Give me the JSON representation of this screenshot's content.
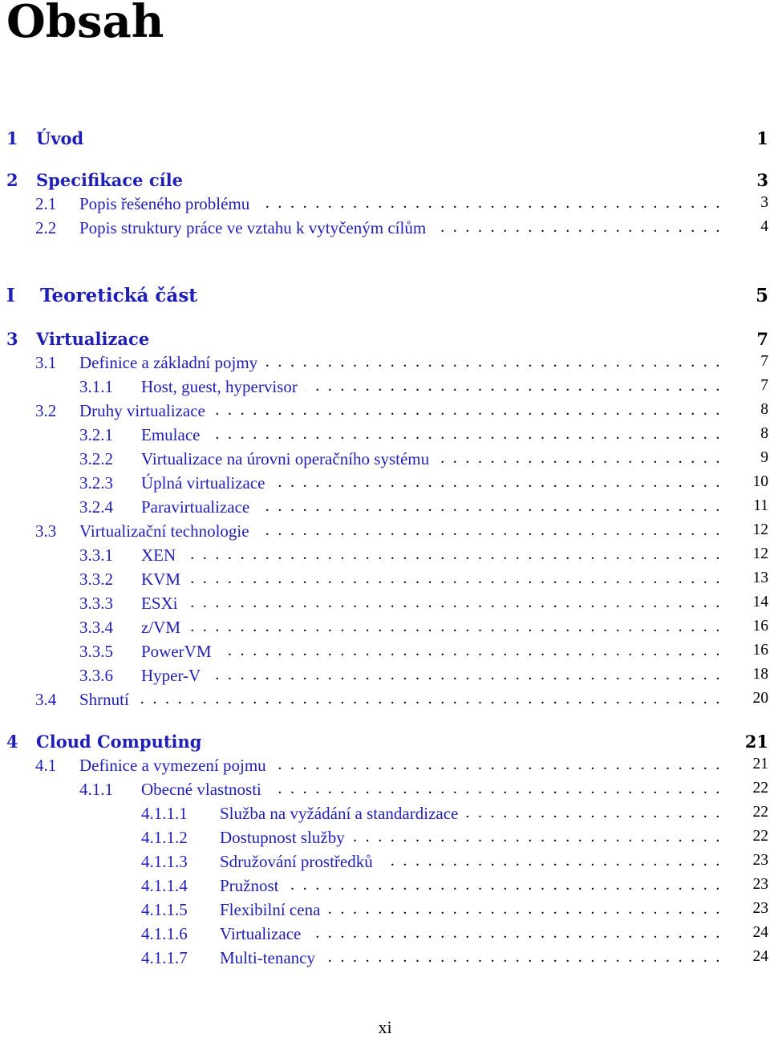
{
  "title": "Obsah",
  "link_color": "#1f1fb5",
  "entries": [
    {
      "level": "chapter",
      "num": "1",
      "title": "Úvod",
      "page": "1"
    },
    {
      "level": "chapter",
      "num": "2",
      "title": "Specifikace cíle",
      "page": "3"
    },
    {
      "level": "section",
      "num": "2.1",
      "title": "Popis řešeného problému",
      "page": "3"
    },
    {
      "level": "section",
      "num": "2.2",
      "title": "Popis struktury práce ve vztahu k vytyčeným cílům",
      "page": "4"
    },
    {
      "level": "part",
      "num": "I",
      "title": "Teoretická část",
      "page": "5"
    },
    {
      "level": "chapter",
      "num": "3",
      "title": "Virtualizace",
      "page": "7"
    },
    {
      "level": "section",
      "num": "3.1",
      "title": "Definice a základní pojmy",
      "page": "7"
    },
    {
      "level": "subsection",
      "num": "3.1.1",
      "title": "Host, guest, hypervisor",
      "page": "7"
    },
    {
      "level": "section",
      "num": "3.2",
      "title": "Druhy virtualizace",
      "page": "8"
    },
    {
      "level": "subsection",
      "num": "3.2.1",
      "title": "Emulace",
      "page": "8"
    },
    {
      "level": "subsection",
      "num": "3.2.2",
      "title": "Virtualizace na úrovni operačního systému",
      "page": "9"
    },
    {
      "level": "subsection",
      "num": "3.2.3",
      "title": "Úplná virtualizace",
      "page": "10"
    },
    {
      "level": "subsection",
      "num": "3.2.4",
      "title": "Paravirtualizace",
      "page": "11"
    },
    {
      "level": "section",
      "num": "3.3",
      "title": "Virtualizační technologie",
      "page": "12"
    },
    {
      "level": "subsection",
      "num": "3.3.1",
      "title": "XEN",
      "page": "12"
    },
    {
      "level": "subsection",
      "num": "3.3.2",
      "title": "KVM",
      "page": "13"
    },
    {
      "level": "subsection",
      "num": "3.3.3",
      "title": "ESXi",
      "page": "14"
    },
    {
      "level": "subsection",
      "num": "3.3.4",
      "title": "z/VM",
      "page": "16"
    },
    {
      "level": "subsection",
      "num": "3.3.5",
      "title": "PowerVM",
      "page": "16"
    },
    {
      "level": "subsection",
      "num": "3.3.6",
      "title": "Hyper-V",
      "page": "18"
    },
    {
      "level": "section",
      "num": "3.4",
      "title": "Shrnutí",
      "page": "20"
    },
    {
      "level": "chapter",
      "num": "4",
      "title": "Cloud Computing",
      "page": "21"
    },
    {
      "level": "section",
      "num": "4.1",
      "title": "Definice a vymezení pojmu",
      "page": "21"
    },
    {
      "level": "subsection",
      "num": "4.1.1",
      "title": "Obecné vlastnosti",
      "page": "22"
    },
    {
      "level": "subsubsection",
      "num": "4.1.1.1",
      "title": "Služba na vyžádání a standardizace",
      "page": "22"
    },
    {
      "level": "subsubsection",
      "num": "4.1.1.2",
      "title": "Dostupnost služby",
      "page": "22"
    },
    {
      "level": "subsubsection",
      "num": "4.1.1.3",
      "title": "Sdružování prostředků",
      "page": "23"
    },
    {
      "level": "subsubsection",
      "num": "4.1.1.4",
      "title": "Pružnost",
      "page": "23"
    },
    {
      "level": "subsubsection",
      "num": "4.1.1.5",
      "title": "Flexibilní cena",
      "page": "23"
    },
    {
      "level": "subsubsection",
      "num": "4.1.1.6",
      "title": "Virtualizace",
      "page": "24"
    },
    {
      "level": "subsubsection",
      "num": "4.1.1.7",
      "title": "Multi-tenancy",
      "page": "24"
    }
  ],
  "footer": {
    "page_number": "xi"
  }
}
